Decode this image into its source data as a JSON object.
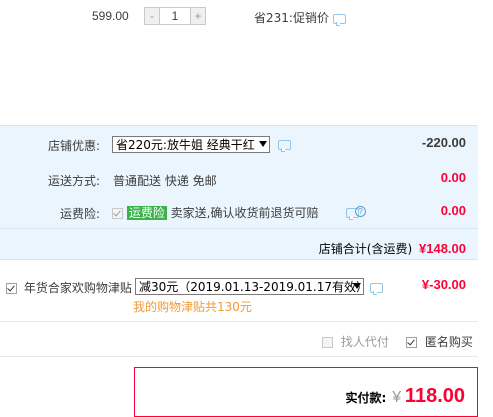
{
  "item": {
    "price": "599.00",
    "quantity": "1",
    "minus_label": "-",
    "plus_label": "+",
    "savings_text": "省231:促销价"
  },
  "shop_discount": {
    "label": "店铺优惠:",
    "selected_option": "省220元:放牛姐 经典干红",
    "amount": "-220.00"
  },
  "shipping": {
    "label": "运送方式:",
    "value": "普通配送 快递 免邮",
    "amount": "0.00"
  },
  "insurance": {
    "label": "运费险:",
    "badge": "运费险",
    "text": "卖家送,确认收货前退货可赔",
    "amount": "0.00",
    "help_glyph": "?"
  },
  "shop_total": {
    "label": "店铺合计(含运费)",
    "amount": "¥148.00"
  },
  "holiday_subsidy": {
    "label": "年货合家欢购物津贴",
    "selected_option": "减30元（2019.01.13-2019.01.17有效）",
    "amount": "¥-30.00",
    "note": "我的购物津贴共130元"
  },
  "options": {
    "proxy_pay_label": "找人代付",
    "anonymous_label": "匿名购买"
  },
  "payment": {
    "label": "实付款:",
    "currency": "¥",
    "amount": "118.00"
  },
  "colors": {
    "price_red": "#ff0036",
    "panel_blue": "#eaf5fd",
    "note_orange": "#f19a38",
    "badge_green": "#3bb34a"
  }
}
